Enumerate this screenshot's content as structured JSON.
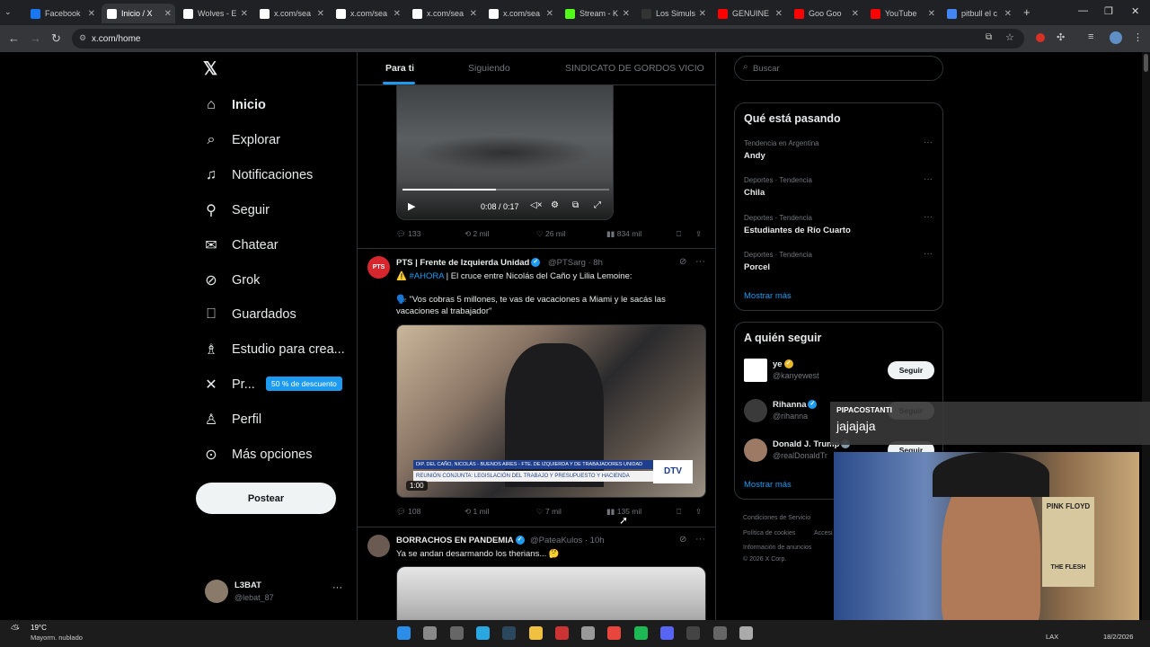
{
  "browser": {
    "tabs": [
      {
        "label": "Facebook",
        "color": "#1877f2"
      },
      {
        "label": "Inicio / X",
        "color": "#ffffff",
        "active": true
      },
      {
        "label": "Wolves - E",
        "color": "#ffffff"
      },
      {
        "label": "x.com/sea",
        "color": "#ffffff"
      },
      {
        "label": "x.com/sea",
        "color": "#ffffff"
      },
      {
        "label": "x.com/sea",
        "color": "#ffffff"
      },
      {
        "label": "x.com/sea",
        "color": "#ffffff"
      },
      {
        "label": "Stream - K",
        "color": "#53fc18"
      },
      {
        "label": "Los Simuls",
        "color": "#333333"
      },
      {
        "label": "GENUINE",
        "color": "#ff0000"
      },
      {
        "label": "Goo Goo",
        "color": "#ff0000"
      },
      {
        "label": "YouTube",
        "color": "#ff0000"
      },
      {
        "label": "pitbull el c",
        "color": "#4285f4"
      }
    ],
    "url": "x.com/home"
  },
  "nav": {
    "items": [
      {
        "label": "Inicio",
        "icon": "home-icon",
        "glyph": "⌂"
      },
      {
        "label": "Explorar",
        "icon": "search-icon",
        "glyph": "⌕"
      },
      {
        "label": "Notificaciones",
        "icon": "bell-icon",
        "glyph": "♫"
      },
      {
        "label": "Seguir",
        "icon": "add-user-icon",
        "glyph": "⚲"
      },
      {
        "label": "Chatear",
        "icon": "mail-icon",
        "glyph": "✉"
      },
      {
        "label": "Grok",
        "icon": "grok-icon",
        "glyph": "⊘"
      },
      {
        "label": "Guardados",
        "icon": "bookmark-icon",
        "glyph": "⎕"
      },
      {
        "label": "Estudio para crea...",
        "icon": "creator-studio-icon",
        "glyph": "♗"
      },
      {
        "label": "Pr...",
        "icon": "x-premium-icon",
        "glyph": "✕"
      },
      {
        "label": "Perfil",
        "icon": "profile-icon",
        "glyph": "♙"
      },
      {
        "label": "Más opciones",
        "icon": "more-options-icon",
        "glyph": "⊙"
      }
    ],
    "promo_badge": "50 % de descuento",
    "post_button": "Postear",
    "account_name": "L3BAT",
    "account_handle": "@lebat_87"
  },
  "timeline": {
    "tabs": [
      "Para ti",
      "Siguiendo",
      "SINDICATO DE GORDOS VICIO"
    ],
    "video_time": "0:08 / 0:17",
    "tweet0_actions": {
      "replies": "133",
      "reposts": "2 mil",
      "likes": "26 mil",
      "views": "834 mil"
    },
    "tweet1": {
      "name": "PTS | Frente de Izquierda Unidad",
      "handle": "@PTSarg · 8h",
      "avatar_text": "PTS",
      "line1_emoji": "⚠️",
      "line1_tag": "#AHORA",
      "line1_text": "| El cruce entre Nicolás del Caño y Lilia Lemoine:",
      "line2_emoji": "🗣️",
      "line2_text": "\"Vos cobras 5 millones, te vas de vacaciones a Miami y le sacás las vacaciones al trabajador\"",
      "chyron_top": "DIP. DEL CAÑO, NICOLÁS - BUENOS AIRES - FTE. DE IZQUIERDA Y DE TRABAJADORES UNIDAD",
      "chyron_bottom": "REUNIÓN CONJUNTA: LEGISLACIÓN DEL TRABAJO Y PRESUPUESTO Y HACIENDA",
      "channel_logo": "DTV",
      "video_duration": "1:00",
      "actions": {
        "replies": "108",
        "reposts": "1 mil",
        "likes": "7 mil",
        "views": "135 mil"
      }
    },
    "tweet2": {
      "name": "BORRACHOS EN PANDEMIA",
      "handle": "@PateaKulos · 10h",
      "text": "Ya se andan desarmando los therians... 🤔"
    }
  },
  "sidebar": {
    "search_placeholder": "Buscar",
    "trends_title": "Qué está pasando",
    "trends": [
      {
        "meta": "Tendencia en Argentina",
        "name": "Andy"
      },
      {
        "meta": "Deportes · Tendencia",
        "name": "Chila"
      },
      {
        "meta": "Deportes · Tendencia",
        "name": "Estudiantes de Río Cuarto"
      },
      {
        "meta": "Deportes · Tendencia",
        "name": "Porcel"
      }
    ],
    "trends_show_more": "Mostrar más",
    "follow_title": "A quién seguir",
    "follow": [
      {
        "name": "ye",
        "handle": "@kanyewest",
        "button": "Seguir"
      },
      {
        "name": "Rihanna",
        "handle": "@rihanna",
        "button": "Seguir"
      },
      {
        "name": "Donald J. Trump",
        "handle": "@realDonaldTr",
        "button": "Seguir"
      }
    ],
    "follow_show_more": "Mostrar más",
    "footer": [
      "Condiciones de Servicio",
      "Política de cookies",
      "Accesi",
      "Información de anuncios",
      "© 2026 X Corp."
    ]
  },
  "overlay": {
    "chat_user": "PIPACOSTANTI",
    "chat_message": "jajajaja",
    "poster_text": "PINK FLOYD",
    "poster_sub": "THE FLESH"
  },
  "taskbar": {
    "temperature": "19°C",
    "weather": "Mayorm. nublado",
    "lang": "LAX",
    "date": "18/2/2026"
  }
}
